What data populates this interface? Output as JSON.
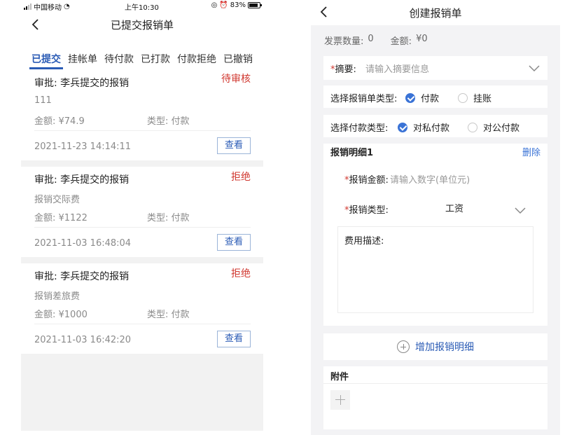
{
  "left": {
    "status_bar": {
      "carrier": "中国移动",
      "time": "上午10:30",
      "battery": "83%"
    },
    "nav": {
      "title": "已提交报销单"
    },
    "tabs": [
      {
        "label": "已提交",
        "active": true
      },
      {
        "label": "挂帐单",
        "active": false
      },
      {
        "label": "待付款",
        "active": false
      },
      {
        "label": "已打款",
        "active": false
      },
      {
        "label": "付款拒绝",
        "active": false
      },
      {
        "label": "已撤销",
        "active": false
      }
    ],
    "cards": [
      {
        "title": "审批: 李兵提交的报销",
        "status": "待审核",
        "desc": "111",
        "amount": "金额: ¥74.9",
        "type": "类型: 付款",
        "time": "2021-11-23 14:14:11",
        "view_label": "查看"
      },
      {
        "title": "审批: 李兵提交的报销",
        "status": "拒绝",
        "desc": "报销交际费",
        "amount": "金额: ¥1122",
        "type": "类型: 付款",
        "time": "2021-11-03 16:48:04",
        "view_label": "查看"
      },
      {
        "title": "审批: 李兵提交的报销",
        "status": "拒绝",
        "desc": "报销差旅费",
        "amount": "金额: ¥1000",
        "type": "类型: 付款",
        "time": "2021-11-03 16:42:20",
        "view_label": "查看"
      }
    ],
    "colors": {
      "accent": "#2a5bb5",
      "status_red": "#d0372f"
    }
  },
  "right": {
    "nav": {
      "title": "创建报销单"
    },
    "summary": {
      "invoice_label": "发票数量:",
      "invoice_value": "0",
      "amount_label": "金额:",
      "amount_value": "¥0"
    },
    "abstract": {
      "label": "摘要:",
      "placeholder": "请输入摘要信息"
    },
    "report_type": {
      "label": "选择报销单类型:",
      "options": [
        {
          "label": "付款",
          "checked": true
        },
        {
          "label": "挂账",
          "checked": false
        }
      ]
    },
    "pay_type": {
      "label": "选择付款类型:",
      "options": [
        {
          "label": "对私付款",
          "checked": true
        },
        {
          "label": "对公付款",
          "checked": false
        }
      ]
    },
    "detail": {
      "title": "报销明细1",
      "delete_label": "删除",
      "amount_label": "报销金额:",
      "amount_placeholder": "请输入数字(单位元)",
      "type_label": "报销类型:",
      "type_value": "工资",
      "desc_label": "费用描述:"
    },
    "add_detail_label": "增加报销明细",
    "attachment": {
      "title": "附件"
    }
  }
}
